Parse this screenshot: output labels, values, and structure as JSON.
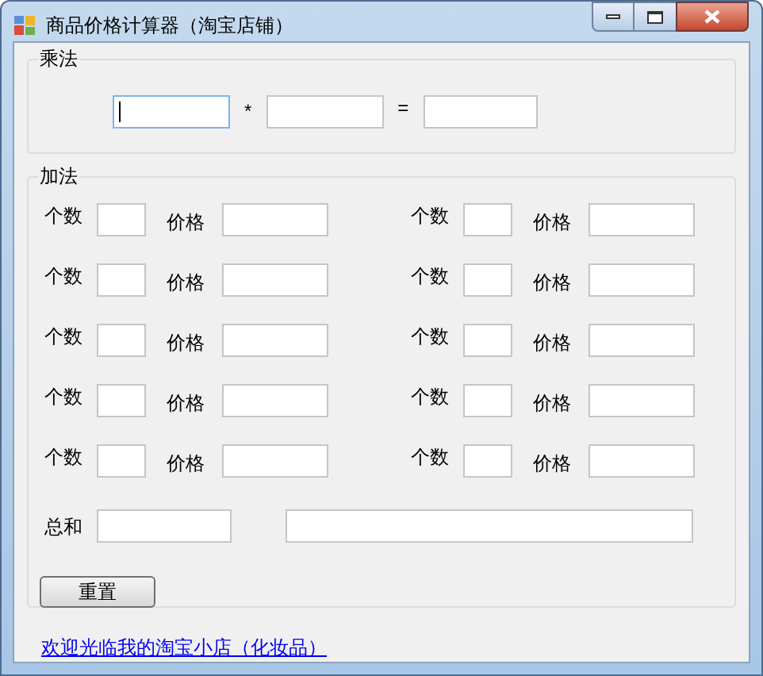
{
  "window": {
    "title": "商品价格计算器（淘宝店铺）"
  },
  "multiply": {
    "label": "乘法",
    "fields": [
      {
        "focused": true
      },
      {
        "focused": false
      },
      {
        "focused": false
      }
    ],
    "operators": [
      "*",
      "="
    ]
  },
  "addition": {
    "label": "加法",
    "rows": [
      {
        "pairs": [
          {
            "count_label": "个数",
            "price_label": "价格"
          },
          {
            "count_label": "个数",
            "price_label": "价格"
          }
        ]
      },
      {
        "pairs": [
          {
            "count_label": "个数",
            "price_label": "价格"
          },
          {
            "count_label": "个数",
            "price_label": "价格"
          }
        ]
      },
      {
        "pairs": [
          {
            "count_label": "个数",
            "price_label": "价格"
          },
          {
            "count_label": "个数",
            "price_label": "价格"
          }
        ]
      },
      {
        "pairs": [
          {
            "count_label": "个数",
            "price_label": "价格"
          },
          {
            "count_label": "个数",
            "price_label": "价格"
          }
        ]
      },
      {
        "pairs": [
          {
            "count_label": "个数",
            "price_label": "价格"
          },
          {
            "count_label": "个数",
            "price_label": "价格"
          }
        ]
      }
    ],
    "total_label": "总和",
    "reset_button": "重置"
  },
  "link": "欢迎光临我的淘宝小店（化妆品）"
}
